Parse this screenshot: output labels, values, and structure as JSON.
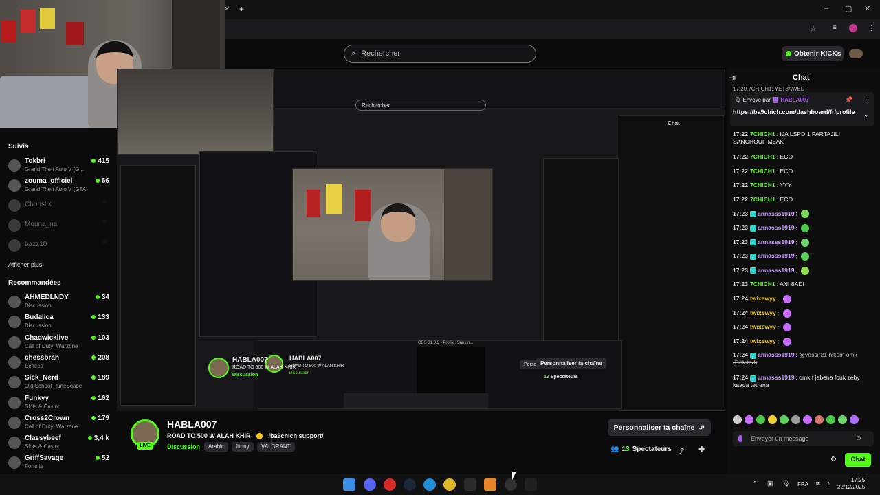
{
  "browser": {
    "window_controls": {
      "minimize": "–",
      "maximize": "▢",
      "close": "✕"
    },
    "new_tab": "+",
    "tab_close": "✕"
  },
  "topbar": {
    "search_placeholder": "Rechercher",
    "kicks_button": "Obtenir KICKs"
  },
  "sidebar": {
    "followed_heading": "Suivis",
    "followed": [
      {
        "name": "Tokbri",
        "game": "Grand Theft Auto V (G...",
        "viewers": "415",
        "online": true
      },
      {
        "name": "zouma_officiel",
        "game": "Grand Theft Auto V (GTA)",
        "viewers": "66",
        "online": true
      },
      {
        "name": "Chopstix",
        "game": "",
        "viewers": "",
        "online": false
      },
      {
        "name": "Mouna_na",
        "game": "",
        "viewers": "",
        "online": false
      },
      {
        "name": "bazz10",
        "game": "",
        "viewers": "",
        "online": false
      }
    ],
    "show_more": "Afficher plus",
    "recommended_heading": "Recommandées",
    "recommended": [
      {
        "name": "AHMEDLNDY",
        "game": "Discussion",
        "viewers": "34"
      },
      {
        "name": "Budalica",
        "game": "Discussion",
        "viewers": "133"
      },
      {
        "name": "Chadwicklive",
        "game": "Call of Duty: Warzone",
        "viewers": "103"
      },
      {
        "name": "chessbrah",
        "game": "Échecs",
        "viewers": "208"
      },
      {
        "name": "Sick_Nerd",
        "game": "Old School RuneScape",
        "viewers": "189"
      },
      {
        "name": "Funkyy",
        "game": "Slots & Casino",
        "viewers": "162"
      },
      {
        "name": "Cross2Crown",
        "game": "Call of Duty: Warzone",
        "viewers": "179"
      },
      {
        "name": "Classybeef",
        "game": "Slots & Casino",
        "viewers": "3,4 k"
      },
      {
        "name": "GriffSavage",
        "game": "Fortnite",
        "viewers": "52"
      }
    ]
  },
  "stream": {
    "streamer": "HABLA007",
    "live": "LIVE",
    "title": "ROAD TO 500 W ALAH KHIR",
    "title_suffix": "/ba9chich support/",
    "category": "Discussion",
    "tags": [
      "Arabic",
      "funny",
      "VALORANT"
    ],
    "personalize": "Personnaliser ta chaîne",
    "viewers": "13",
    "viewers_label": "Spectateurs",
    "inner_obs_label": "OBS 31.0.3 - Profile: Sans n..."
  },
  "chat": {
    "title": "Chat",
    "pinned_by_label": "Envoyé par",
    "pinned_by_user": "HABLA007",
    "pinned_link": "https://ba9chich.com/dashboard/fr/profile",
    "top_cut": "17:20 7CHICH1: YET3AWED",
    "messages": [
      {
        "time": "17:22",
        "user": "7CHICH1",
        "color": "#53fc18",
        "text": "IJA LSPD 1 PARTAJILI SANCHOUF M3AK",
        "badge": false,
        "emote": ""
      },
      {
        "time": "17:22",
        "user": "7CHICH1",
        "color": "#53fc18",
        "text": "ECO",
        "badge": false,
        "emote": ""
      },
      {
        "time": "17:22",
        "user": "7CHICH1",
        "color": "#53fc18",
        "text": "ECO",
        "badge": false,
        "emote": ""
      },
      {
        "time": "17:22",
        "user": "7CHICH1",
        "color": "#53fc18",
        "text": "YYY",
        "badge": false,
        "emote": ""
      },
      {
        "time": "17:22",
        "user": "7CHICH1",
        "color": "#53fc18",
        "text": "ECO",
        "badge": false,
        "emote": ""
      },
      {
        "time": "17:23",
        "user": "annasss1919",
        "color": "#c89bff",
        "text": "",
        "badge": true,
        "emote": "#7ed957"
      },
      {
        "time": "17:23",
        "user": "annasss1919",
        "color": "#c89bff",
        "text": "",
        "badge": true,
        "emote": "#4cc94c"
      },
      {
        "time": "17:23",
        "user": "annasss1919",
        "color": "#c89bff",
        "text": "",
        "badge": true,
        "emote": "#6fd66f"
      },
      {
        "time": "17:23",
        "user": "annasss1919",
        "color": "#c89bff",
        "text": "",
        "badge": true,
        "emote": "#5bd35b"
      },
      {
        "time": "17:23",
        "user": "annasss1919",
        "color": "#c89bff",
        "text": "",
        "badge": true,
        "emote": "#8ee04a"
      },
      {
        "time": "17:23",
        "user": "7CHICH1",
        "color": "#53fc18",
        "text": "ANI 8ADI",
        "badge": false,
        "emote": ""
      },
      {
        "time": "17:24",
        "user": "twixewyy",
        "color": "#f0c419",
        "text": "",
        "badge": false,
        "emote": "#c76dff"
      },
      {
        "time": "17:24",
        "user": "twixewyy",
        "color": "#f0c419",
        "text": "",
        "badge": false,
        "emote": "#c76dff"
      },
      {
        "time": "17:24",
        "user": "twixewyy",
        "color": "#f0c419",
        "text": "",
        "badge": false,
        "emote": "#c76dff"
      },
      {
        "time": "17:24",
        "user": "twixewyy",
        "color": "#f0c419",
        "text": "",
        "badge": false,
        "emote": "#c76dff"
      },
      {
        "time": "17:24",
        "user": "annasss1919",
        "color": "#c89bff",
        "text": "@yessir21 nikom omk (Deleted)",
        "badge": true,
        "emote": ""
      },
      {
        "time": "17:24",
        "user": "annasss1919",
        "color": "#c89bff",
        "text": "omk f jabena fouk zeby kaada tetrena",
        "badge": true,
        "emote": ""
      }
    ],
    "input_placeholder": "Envoyer un message",
    "send_button": "Chat",
    "emote_colors": [
      "#cfcfcf",
      "#c76dff",
      "#4cc94c",
      "#f0d030",
      "#5bd35b",
      "#9b9b9b",
      "#c76dff",
      "#d47a6a",
      "#4cc94c",
      "#6fd66f",
      "#b070ff"
    ]
  },
  "taskbar": {
    "language": "FRA",
    "time": "17:25",
    "date": "22/12/2025"
  },
  "colors": {
    "accent": "#53fc18",
    "background": "#0b0b0c"
  }
}
